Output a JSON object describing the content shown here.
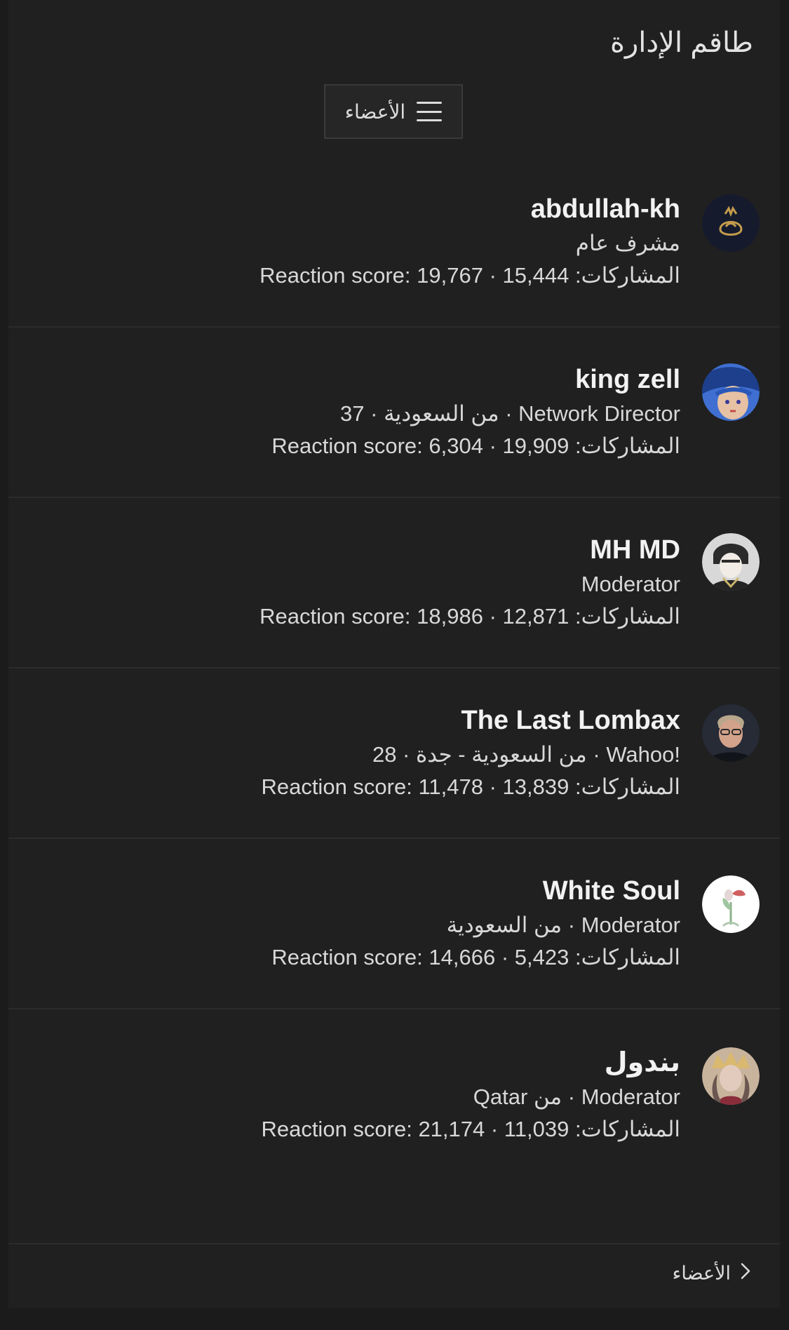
{
  "header": {
    "title": "طاقم الإدارة",
    "tab_label": "الأعضاء"
  },
  "members": [
    {
      "name": "abdullah-kh",
      "meta": "مشرف عام",
      "stats": "Reaction score: 19,767 · 15,444 :المشاركات",
      "avatar_colors": [
        "#151b2d",
        "#c59c4c"
      ]
    },
    {
      "name": "king zell",
      "meta": "من السعودية · 37 · Network Director",
      "stats": "Reaction score: 6,304 · 19,909 :المشاركات",
      "avatar_colors": [
        "#3f6fd0",
        "#e6c1a3"
      ]
    },
    {
      "name": "MH MD",
      "meta": "Moderator",
      "stats": "Reaction score: 18,986 · 12,871 :المشاركات",
      "avatar_colors": [
        "#d8d8d8",
        "#2b2b2b"
      ]
    },
    {
      "name": "The Last Lombax",
      "meta": "من السعودية - جدة · 28 · Wahoo!",
      "stats": "Reaction score: 11,478 · 13,839 :المشاركات",
      "avatar_colors": [
        "#262b36",
        "#d3a28a"
      ]
    },
    {
      "name": "White Soul",
      "meta": "من السعودية · Moderator",
      "stats": "Reaction score: 14,666 · 5,423 :المشاركات",
      "avatar_colors": [
        "#ffffff",
        "#8db38d"
      ]
    },
    {
      "name": "بندول",
      "meta": "Qatar من · Moderator",
      "stats": "Reaction score: 21,174 · 11,039 :المشاركات",
      "avatar_colors": [
        "#c8b39c",
        "#6b5650"
      ]
    }
  ],
  "footer": {
    "link_label": "الأعضاء"
  }
}
